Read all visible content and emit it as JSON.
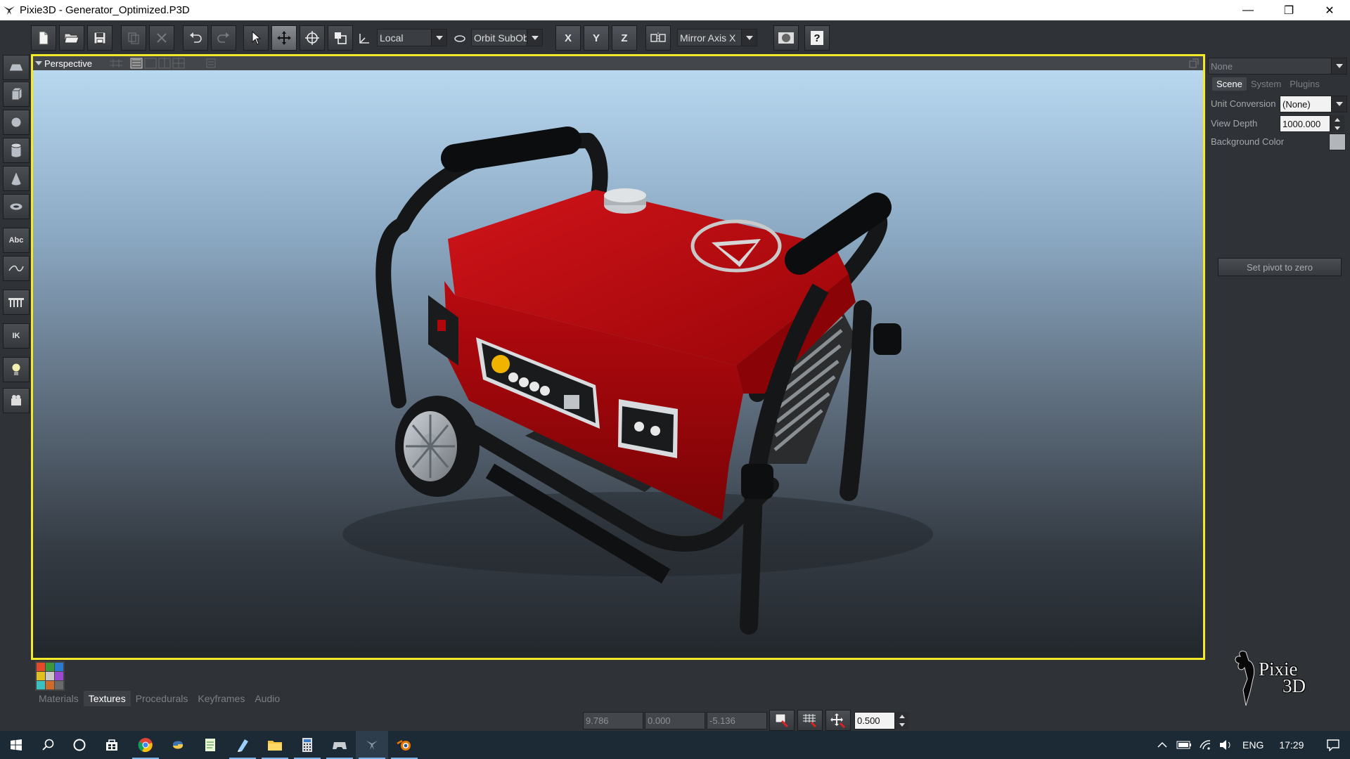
{
  "window": {
    "title": "Pixie3D - Generator_Optimized.P3D",
    "minimize": "—",
    "maximize": "❐",
    "close": "✕"
  },
  "toolbar": {
    "coord_space": "Local",
    "orbit_mode": "Orbit SubOb",
    "axis_x": "X",
    "axis_y": "Y",
    "axis_z": "Z",
    "mirror_axis": "Mirror Axis X",
    "help": "?"
  },
  "left_tools": {
    "text_label": "Abc",
    "ik_label": "IK"
  },
  "viewport": {
    "title": "Perspective"
  },
  "right_panel": {
    "object_select": "None",
    "tabs": [
      {
        "label": "Scene"
      },
      {
        "label": "System"
      },
      {
        "label": "Plugins"
      }
    ],
    "unit_conversion_label": "Unit Conversion",
    "unit_conversion_value": "(None)",
    "view_depth_label": "View Depth",
    "view_depth_value": "1000.000",
    "background_color_label": "Background Color",
    "background_color": "#b2b6ba",
    "set_pivot_button": "Set pivot to zero"
  },
  "bottom_panel": {
    "tabs": [
      {
        "label": "Materials"
      },
      {
        "label": "Textures"
      },
      {
        "label": "Procedurals"
      },
      {
        "label": "Keyframes"
      },
      {
        "label": "Audio"
      }
    ],
    "coord_x": "9.786",
    "coord_y": "0.000",
    "coord_z": "-5.136",
    "step_value": "0.500"
  },
  "logo": {
    "line1": "Pixie",
    "line2": "3D"
  },
  "taskbar": {
    "language": "ENG",
    "time": "17:29"
  },
  "colors": {
    "viewport_border": "#f5ea2a",
    "generator_red": "#b0070b",
    "frame_black": "#151617"
  }
}
